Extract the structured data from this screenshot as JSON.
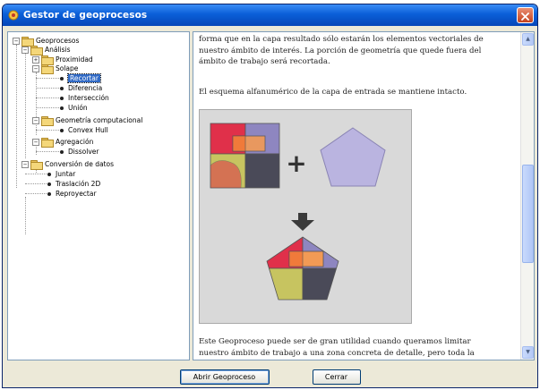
{
  "window": {
    "title": "Gestor de geoprocesos",
    "close_label": "×"
  },
  "tree": {
    "root": "Geoprocesos",
    "analisis": "Análisis",
    "proximidad": "Proximidad",
    "solape": "Solape",
    "recortar": "Recortar",
    "diferencia": "Diferencia",
    "interseccion": "Intersección",
    "union": "Unión",
    "geometria": "Geometría computacional",
    "convex_hull": "Convex Hull",
    "agregacion": "Agregación",
    "dissolver": "Dissolver",
    "conversion": "Conversión de datos",
    "juntar": "Juntar",
    "traslacion": "Traslación 2D",
    "reproyectar": "Reproyectar",
    "expand_open": "−",
    "expand_closed": "+"
  },
  "content": {
    "paragraph1_line1": "forma que en la capa resultado sólo estarán los elementos vectoriales de",
    "paragraph1_line2": "nuestro ámbito de interés. La porción de geometría que quede fuera del",
    "paragraph1_line3": "ámbito de trabajo será recortada.",
    "paragraph2": "El esquema alfanumérico de la capa de entrada se mantiene intacto.",
    "plus_sign": "+",
    "paragraph3_line1": "Este Geoproceso puede ser de gran utilidad cuando queramos limitar",
    "paragraph3_line2": "nuestro ámbito de trabajo a una zona concreta de detalle, pero toda la"
  },
  "scrollbar": {
    "up_arrow": "▲",
    "down_arrow": "▼"
  },
  "buttons": {
    "open_label": "Abrir Geoproceso",
    "close_label": "Cerrar"
  },
  "colors": {
    "title_bar": "#0a5fd8",
    "selection": "#316ac5",
    "poly_red": "#e0304a",
    "poly_lilac": "#8e86c0",
    "poly_olive": "#c7c460",
    "poly_dark": "#4a4a58",
    "poly_orange": "#f29a55",
    "pentagon_fill": "#bab4e0"
  }
}
